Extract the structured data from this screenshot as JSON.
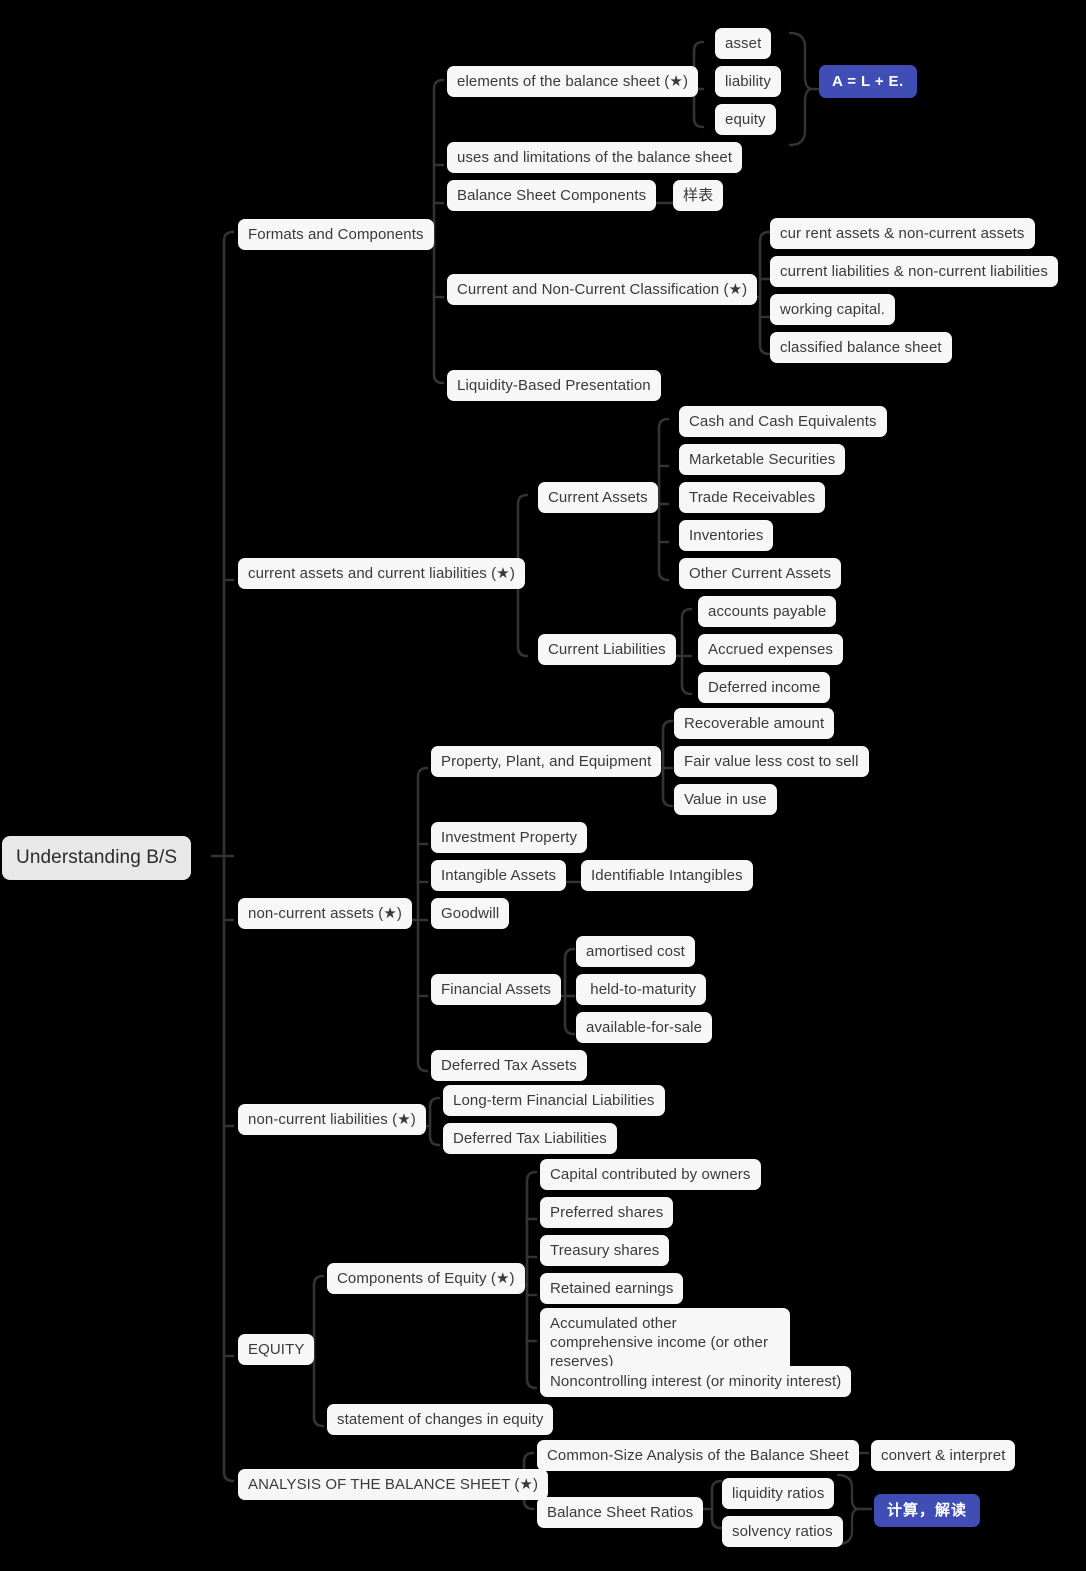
{
  "mindmap": {
    "title": "Understanding B/S",
    "colors": {
      "background": "#000000",
      "node_bg": "#f7f7f7",
      "node_text": "#3a3a3a",
      "root_bg": "#e8e8e8",
      "badge_bg": "#3f4db5",
      "badge_text": "#ffffff",
      "link": "#333333"
    },
    "root": {
      "label": "Understanding B/S"
    },
    "branches": [
      {
        "id": "formats",
        "label": "Formats and Components",
        "children": [
          {
            "id": "elements",
            "label": "elements of the balance sheet (★)",
            "children": [
              {
                "id": "asset",
                "label": "asset"
              },
              {
                "id": "liability",
                "label": "liability"
              },
              {
                "id": "equity",
                "label": "equity"
              }
            ],
            "summary": {
              "id": "ale",
              "label": "A = L + E.",
              "kind": "badge"
            }
          },
          {
            "id": "uses",
            "label": "uses and limitations of the balance sheet"
          },
          {
            "id": "bscomp",
            "label": "Balance Sheet Components",
            "children": [
              {
                "id": "yangbiao",
                "label": "样表"
              }
            ]
          },
          {
            "id": "classification",
            "label": "Current and Non-Current Classification (★)",
            "children": [
              {
                "id": "ca-nca",
                "label": "cur rent assets & non-current assets"
              },
              {
                "id": "cl-ncl",
                "label": "current liabilities & non-current liabilities"
              },
              {
                "id": "wc",
                "label": "working capital."
              },
              {
                "id": "cbs",
                "label": "classified balance sheet"
              }
            ]
          },
          {
            "id": "liquidity-pres",
            "label": "Liquidity-Based Presentation"
          }
        ]
      },
      {
        "id": "ca-cl",
        "label": "current assets and current liabilities (★)",
        "children": [
          {
            "id": "current-assets",
            "label": "Current Assets",
            "children": [
              {
                "id": "cash",
                "label": "Cash and Cash Equivalents"
              },
              {
                "id": "marketable",
                "label": "Marketable Securities"
              },
              {
                "id": "trade-rec",
                "label": "Trade Receivables"
              },
              {
                "id": "inventories",
                "label": "Inventories"
              },
              {
                "id": "other-ca",
                "label": "Other Current Assets"
              }
            ]
          },
          {
            "id": "current-liabilities",
            "label": "Current Liabilities",
            "children": [
              {
                "id": "ap",
                "label": "accounts payable"
              },
              {
                "id": "accrued",
                "label": "Accrued expenses"
              },
              {
                "id": "deferred-inc",
                "label": "Deferred income"
              }
            ]
          }
        ]
      },
      {
        "id": "nca",
        "label": "non-current assets (★)",
        "children": [
          {
            "id": "ppe",
            "label": "Property, Plant, and Equipment",
            "children": [
              {
                "id": "recoverable",
                "label": "Recoverable amount"
              },
              {
                "id": "fvlcs",
                "label": "Fair value less cost to sell"
              },
              {
                "id": "viu",
                "label": "Value in use"
              }
            ]
          },
          {
            "id": "inv-prop",
            "label": "Investment Property"
          },
          {
            "id": "intangibles",
            "label": "Intangible Assets",
            "children": [
              {
                "id": "ident-intang",
                "label": "Identifiable Intangibles"
              }
            ]
          },
          {
            "id": "goodwill",
            "label": "Goodwill"
          },
          {
            "id": "fin-assets",
            "label": "Financial Assets",
            "children": [
              {
                "id": "amortised",
                "label": "amortised cost"
              },
              {
                "id": "htm",
                "label": " held-to-maturity"
              },
              {
                "id": "afs",
                "label": "available-for-sale"
              }
            ]
          },
          {
            "id": "dta",
            "label": "Deferred Tax Assets"
          }
        ]
      },
      {
        "id": "ncl",
        "label": "non-current liabilities (★)",
        "children": [
          {
            "id": "ltfl",
            "label": "Long-term Financial Liabilities"
          },
          {
            "id": "dtl",
            "label": "Deferred Tax Liabilities"
          }
        ]
      },
      {
        "id": "equity-branch",
        "label": "EQUITY",
        "children": [
          {
            "id": "comp-equity",
            "label": "Components of Equity (★)",
            "children": [
              {
                "id": "capital",
                "label": "Capital contributed by owners"
              },
              {
                "id": "pref",
                "label": "Preferred shares"
              },
              {
                "id": "treasury",
                "label": "Treasury shares"
              },
              {
                "id": "retained",
                "label": "Retained earnings"
              },
              {
                "id": "aoci",
                "label": "Accumulated other comprehensive income  (or other reserves)"
              },
              {
                "id": "nci",
                "label": "Noncontrolling interest (or minority interest)"
              }
            ]
          },
          {
            "id": "soce",
            "label": "statement of changes in equity"
          }
        ]
      },
      {
        "id": "analysis",
        "label": "ANALYSIS OF THE BALANCE SHEET (★)",
        "children": [
          {
            "id": "common-size",
            "label": "Common-Size Analysis of the Balance Sheet",
            "children": [
              {
                "id": "convert",
                "label": "convert & interpret"
              }
            ]
          },
          {
            "id": "bs-ratios",
            "label": "Balance Sheet Ratios",
            "children": [
              {
                "id": "liq-ratios",
                "label": "liquidity ratios"
              },
              {
                "id": "solv-ratios",
                "label": "solvency ratios"
              }
            ],
            "summary": {
              "id": "jisuan",
              "label": "计算，解读",
              "kind": "badge"
            }
          }
        ]
      }
    ]
  }
}
